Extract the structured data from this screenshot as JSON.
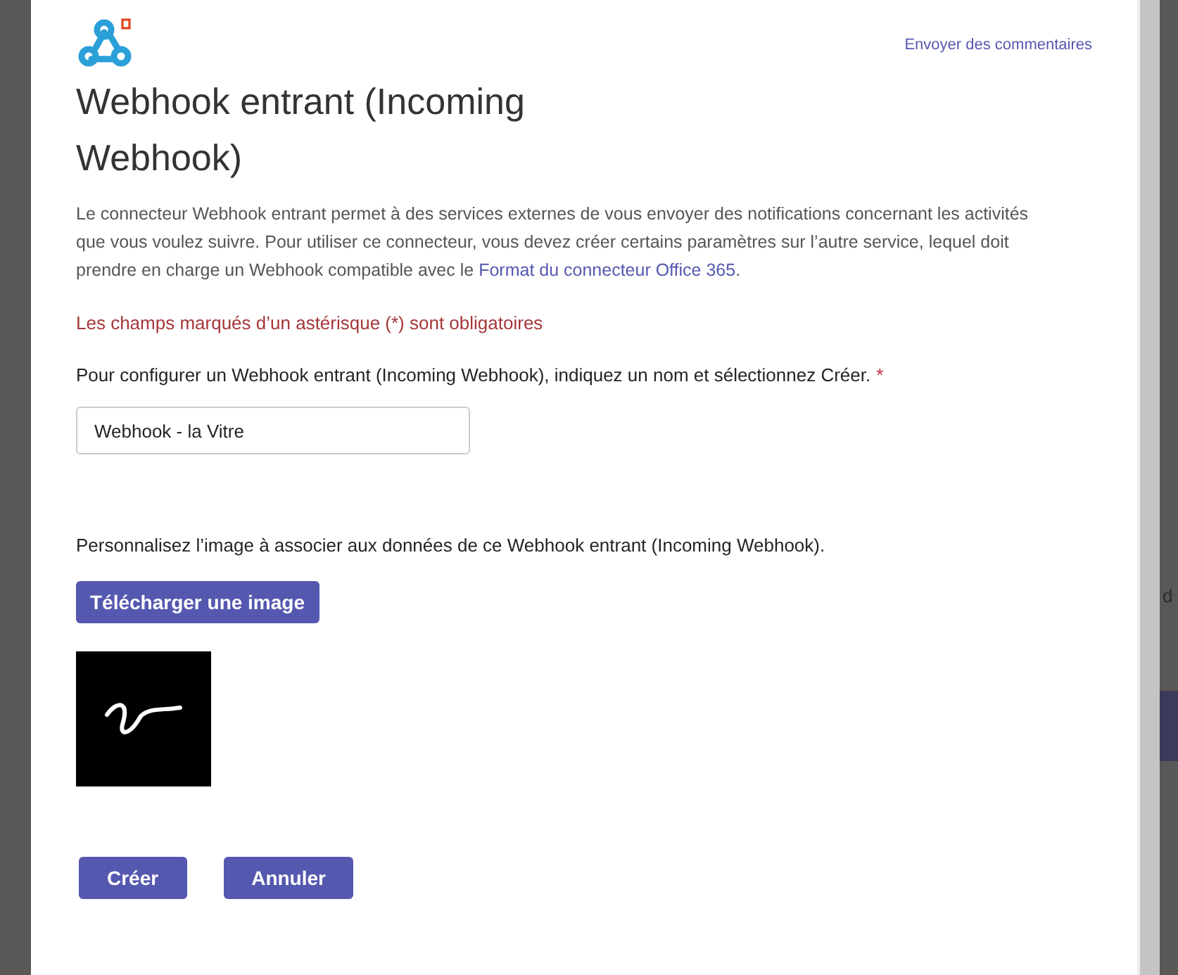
{
  "header": {
    "feedback_link": "Envoyer des commentaires"
  },
  "title": "Webhook entrant (Incoming Webhook)",
  "description": {
    "text": "Le connecteur Webhook entrant permet à des services externes de vous envoyer des notifications concernant les activités que vous voulez suivre. Pour utiliser ce connecteur, vous devez créer certains paramètres sur l’autre service, lequel doit prendre en charge un Webhook compatible avec le",
    "link": "Format du connecteur Office 365",
    "after": "."
  },
  "required_note": "Les champs marqués d’un astérisque (*) sont obligatoires",
  "name_field": {
    "label": "Pour configurer un Webhook entrant (Incoming Webhook), indiquez un nom et sélectionnez Créer.",
    "required_mark": "*",
    "value": "Webhook - la Vitre"
  },
  "image_section": {
    "label": "Personnalisez l’image à associer aux données de ce Webhook entrant (Incoming Webhook).",
    "upload_button": "Télécharger une image"
  },
  "buttons": [
    "Créer",
    "Annuler"
  ],
  "background_text": "d"
}
